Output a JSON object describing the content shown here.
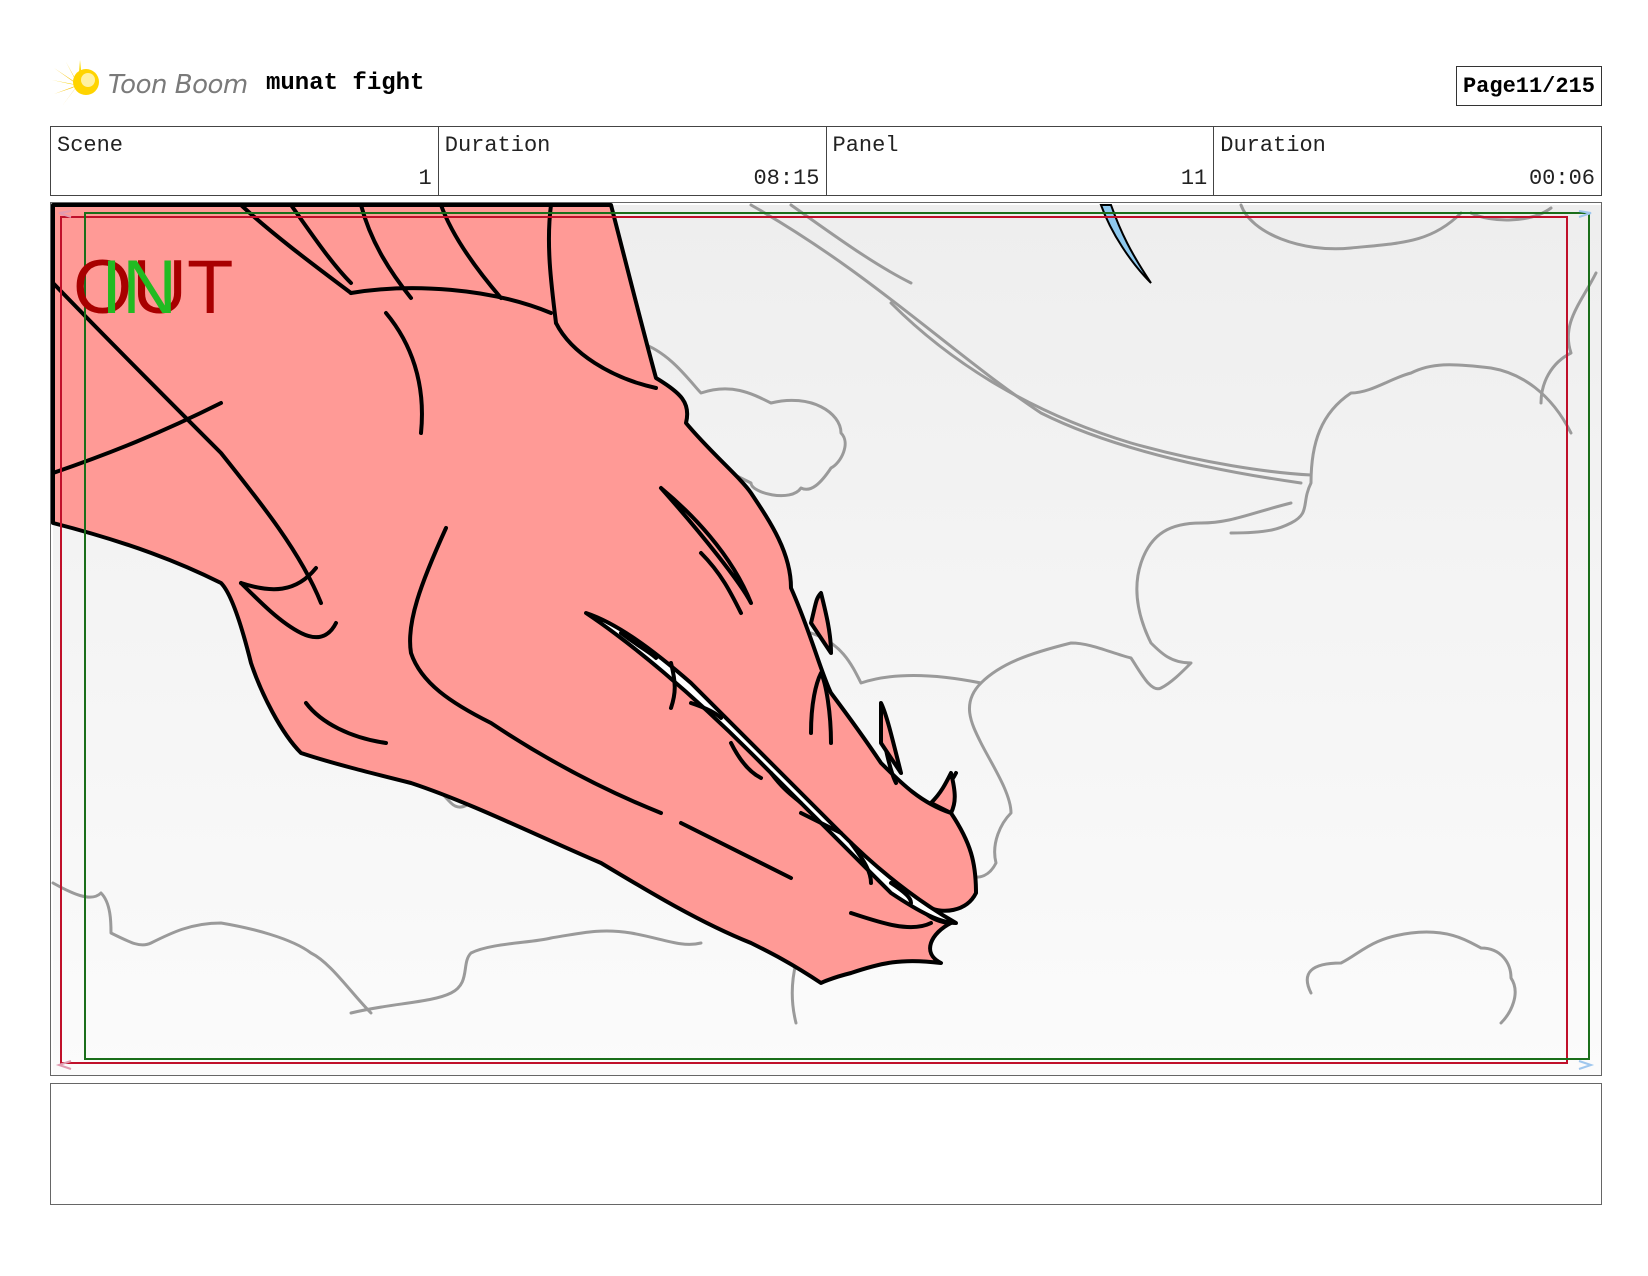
{
  "header": {
    "logo_text": "Toon Boom",
    "project_title": "munat fight",
    "page_label": "Page",
    "page_value": "11/215"
  },
  "info": {
    "scene_label": "Scene",
    "scene_value": "1",
    "scene_duration_label": "Duration",
    "scene_duration_value": "08:15",
    "panel_label": "Panel",
    "panel_value": "11",
    "panel_duration_label": "Duration",
    "panel_duration_value": "00:06"
  },
  "panel": {
    "out_label": "OUT",
    "in_label": "IN",
    "colors": {
      "dragon_fill": "#ff9a96",
      "out_color": "#a80000",
      "in_color": "#22bb22",
      "safe_frame_red": "#c0102a",
      "safe_frame_green": "#1a6e1a",
      "cloud_line": "#999999"
    }
  },
  "notes": {
    "text": ""
  }
}
